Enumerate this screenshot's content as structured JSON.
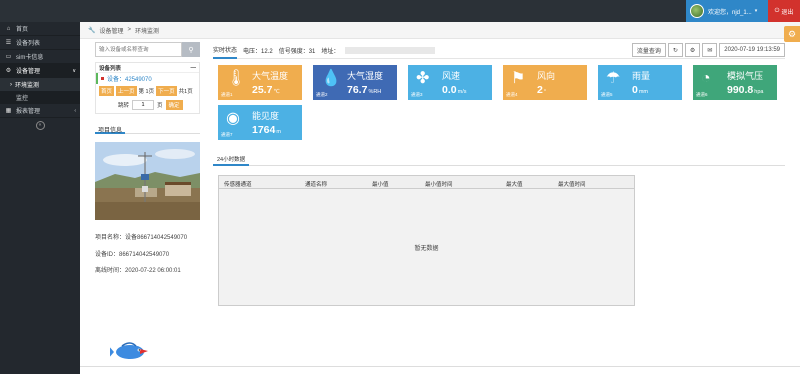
{
  "header": {
    "welcome": "欢迎您，njd_1...",
    "logout_label": "退出"
  },
  "sidebar": {
    "items": [
      {
        "label": "首页",
        "icon": "home-icon"
      },
      {
        "label": "设备列表",
        "icon": "list-icon"
      },
      {
        "label": "sim卡信息",
        "icon": "sim-icon"
      },
      {
        "label": "设备管理",
        "icon": "settings-icon"
      },
      {
        "label": "报表管理",
        "icon": "table-icon"
      }
    ],
    "subitems": [
      {
        "label": "环境监测"
      },
      {
        "label": "监控"
      }
    ]
  },
  "breadcrumb": {
    "root": "设备管理",
    "sep": ">",
    "current": "环境监测"
  },
  "left": {
    "search_placeholder": "输入设备或名称查询",
    "device_list_title": "设备列表",
    "device_list_toggle": "—",
    "device_item": "设备：42549070",
    "pager": {
      "first": "首页",
      "prev": "上一页",
      "page": "第 1页",
      "next": "下一页",
      "total": "共1页"
    },
    "jump_label": "跳转",
    "jump_value": "1",
    "jump_unit": "页",
    "ok_label": "确定",
    "project_tab": "项目信息",
    "project_name": "项目名称：设备866714042549070",
    "device_id": "设备ID：866714042549070",
    "offline_time": "离线时间：2020-07-22 06:00:01"
  },
  "status": {
    "tab": "实时状态",
    "voltage": "电压：12.2",
    "signal": "信号强度：31",
    "address_label": "地址：",
    "flow_query": "流量查询",
    "datetime": "2020-07-19 19:13:59"
  },
  "cards": [
    {
      "name": "大气温度",
      "value": "25.7",
      "unit": "℃",
      "channel": "通道1",
      "color": "#f0ad4e",
      "icon": "thermometer-icon"
    },
    {
      "name": "大气湿度",
      "value": "76.7",
      "unit": "%RH",
      "channel": "通道2",
      "color": "#3f6ab4",
      "icon": "humidity-icon"
    },
    {
      "name": "风速",
      "value": "0.0",
      "unit": "m/s",
      "channel": "通道3",
      "color": "#4cb1e4",
      "icon": "fan-icon"
    },
    {
      "name": "风向",
      "value": "2",
      "unit": "°",
      "channel": "通道4",
      "color": "#f0ad4e",
      "icon": "windsock-icon"
    },
    {
      "name": "雨量",
      "value": "0",
      "unit": "mm",
      "channel": "通道5",
      "color": "#4cb1e4",
      "icon": "rain-icon"
    },
    {
      "name": "模拟气压",
      "value": "990.8",
      "unit": "hpa",
      "channel": "通道6",
      "color": "#3fa67a",
      "icon": "gauge-icon"
    },
    {
      "name": "能见度",
      "value": "1764",
      "unit": "m",
      "channel": "通道7",
      "color": "#4cb1e4",
      "icon": "eye-icon"
    }
  ],
  "history": {
    "tab": "24小时数据",
    "columns": [
      "传感器通道",
      "通道名称",
      "最小值",
      "最小值时间",
      "最大值",
      "最大值时间"
    ],
    "empty": "暂无数据"
  }
}
